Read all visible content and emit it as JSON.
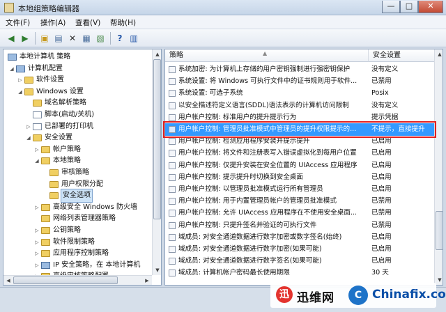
{
  "window": {
    "title": "本地组策略编辑器",
    "min": "—",
    "max": "□",
    "close": "✕"
  },
  "menu": [
    "文件(F)",
    "操作(A)",
    "查看(V)",
    "帮助(H)"
  ],
  "tree": [
    {
      "label": "本地计算机 策略",
      "icon": "computer-policy-icon",
      "indent": 0,
      "tri": ""
    },
    {
      "label": "计算机配置",
      "icon": "computer-icon",
      "indent": 1,
      "tri": "◢"
    },
    {
      "label": "软件设置",
      "icon": "folder-icon",
      "indent": 2,
      "tri": "▷"
    },
    {
      "label": "Windows 设置",
      "icon": "folder-icon",
      "indent": 2,
      "tri": "◢"
    },
    {
      "label": "域名解析策略",
      "icon": "folder-icon",
      "indent": 3,
      "tri": ""
    },
    {
      "label": "脚本(启动/关机)",
      "icon": "script-icon",
      "indent": 3,
      "tri": ""
    },
    {
      "label": "已部署的打印机",
      "icon": "printer-icon",
      "indent": 3,
      "tri": "▷"
    },
    {
      "label": "安全设置",
      "icon": "folder-icon",
      "indent": 3,
      "tri": "◢"
    },
    {
      "label": "帐户策略",
      "icon": "folder-icon",
      "indent": 4,
      "tri": "▷"
    },
    {
      "label": "本地策略",
      "icon": "folder-icon",
      "indent": 4,
      "tri": "◢"
    },
    {
      "label": "审核策略",
      "icon": "folder-icon",
      "indent": 5,
      "tri": ""
    },
    {
      "label": "用户权限分配",
      "icon": "folder-icon",
      "indent": 5,
      "tri": ""
    },
    {
      "label": "安全选项",
      "icon": "folder-icon",
      "indent": 5,
      "tri": "",
      "selected": true
    },
    {
      "label": "高级安全 Windows 防火墙",
      "icon": "folder-icon",
      "indent": 4,
      "tri": "▷"
    },
    {
      "label": "网络列表管理器策略",
      "icon": "folder-icon",
      "indent": 4,
      "tri": ""
    },
    {
      "label": "公钥策略",
      "icon": "folder-icon",
      "indent": 4,
      "tri": "▷"
    },
    {
      "label": "软件限制策略",
      "icon": "folder-icon",
      "indent": 4,
      "tri": "▷"
    },
    {
      "label": "应用程序控制策略",
      "icon": "folder-icon",
      "indent": 4,
      "tri": "▷"
    },
    {
      "label": "IP 安全策略，在 本地计算机",
      "icon": "ip-security-icon",
      "indent": 4,
      "tri": "▷"
    },
    {
      "label": "高级审核策略配置",
      "icon": "folder-icon",
      "indent": 4,
      "tri": "▷"
    }
  ],
  "list": {
    "columns": [
      "策略",
      "安全设置"
    ],
    "rows": [
      {
        "policy": "系统加密: 为计算机上存储的用户密钥强制进行强密钥保护",
        "setting": "没有定义"
      },
      {
        "policy": "系统设置: 将 Windows 可执行文件中的证书规则用于软件...",
        "setting": "已禁用"
      },
      {
        "policy": "系统设置: 可选子系统",
        "setting": "Posix"
      },
      {
        "policy": "以安全描述符定义语言(SDDL)语法表示的计算机访问限制",
        "setting": "没有定义"
      },
      {
        "policy": "用户帐户控制: 标准用户的提升提示行为",
        "setting": "提示凭据"
      },
      {
        "policy": "用户帐户控制: 管理员批准模式中管理员的提升权限提示的...",
        "setting": "不提示，直接提升",
        "highlight": true
      },
      {
        "policy": "用户帐户控制: 检测应用程序安装并提示提升",
        "setting": "已启用"
      },
      {
        "policy": "用户帐户控制: 将文件和注册表写入错误虚拟化到每用户位置",
        "setting": "已启用"
      },
      {
        "policy": "用户帐户控制: 仅提升安装在安全位置的 UIAccess 应用程序",
        "setting": "已启用"
      },
      {
        "policy": "用户帐户控制: 提示提升时切换到安全桌面",
        "setting": "已启用"
      },
      {
        "policy": "用户帐户控制: 以管理员批准模式运行所有管理员",
        "setting": "已启用"
      },
      {
        "policy": "用户帐户控制: 用于内置管理员帐户的管理员批准模式",
        "setting": "已禁用"
      },
      {
        "policy": "用户帐户控制: 允许 UIAccess 应用程序在不使用安全桌面...",
        "setting": "已禁用"
      },
      {
        "policy": "用户帐户控制: 只提升签名并验证的可执行文件",
        "setting": "已禁用"
      },
      {
        "policy": "域成员: 对安全通道数据进行数字加密或数字签名(始终)",
        "setting": "已启用"
      },
      {
        "policy": "域成员: 对安全通道数据进行数字加密(如果可能)",
        "setting": "已启用"
      },
      {
        "policy": "域成员: 对安全通道数据进行数字签名(如果可能)",
        "setting": "已启用"
      },
      {
        "policy": "域成员: 计算机帐户密码最长使用期限",
        "setting": "30 天"
      }
    ]
  },
  "watermark": {
    "logo": "迅",
    "cn": "迅维网",
    "badge": "C",
    "en": "Chinafix.com"
  }
}
